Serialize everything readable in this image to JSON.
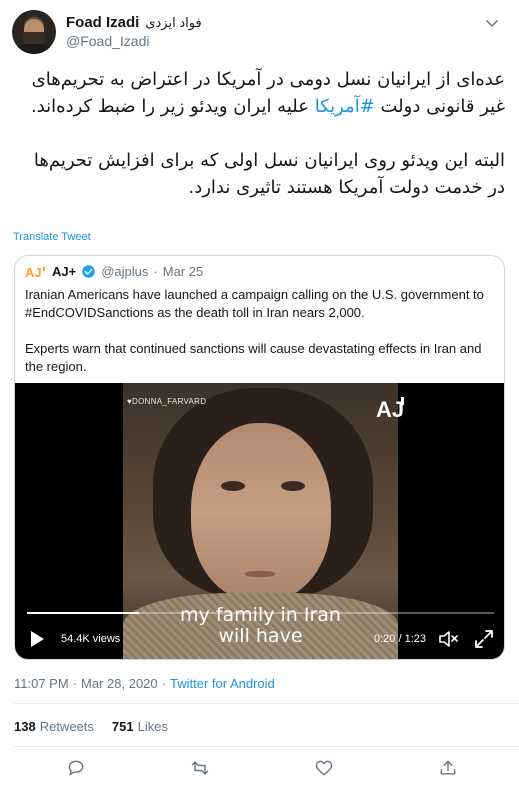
{
  "author": {
    "name": "Foad Izadi",
    "name_fa": "فواد ایزدی",
    "handle": "@Foad_Izadi"
  },
  "tweet": {
    "paragraph1_before": "عده‌ای از ایرانیان نسل دومی در آمریکا در اعتراض به تحریم‌های غیر قانونی دولت ",
    "hashtag": "#آمریکا",
    "paragraph1_after": " علیه ایران ویدئو زیر را ضبط کرده‌اند.",
    "paragraph2": "البته این ویدئو روی ایرانیان نسل اولی که برای افزایش تحریم‌ها در خدمت دولت آمریکا هستند تاثیری ندارد.",
    "translate_label": "Translate Tweet"
  },
  "quoted": {
    "name": "AJ+",
    "handle": "@ajplus",
    "separator": "·",
    "date": "Mar 25",
    "paragraph1": "Iranian Americans have launched a campaign calling on the U.S. government to #EndCOVIDSanctions as the death toll in Iran nears 2,000.",
    "paragraph2": "Experts warn that continued sanctions will cause devastating effects in Iran and the region."
  },
  "video": {
    "watermark": "♥DONNA_FARVARD",
    "caption_line1": "my family in Iran",
    "caption_line2": "will have",
    "views": "54.4K views",
    "time": "0:20 / 1:23",
    "progress": 0.24
  },
  "meta": {
    "time": "11:07 PM",
    "separator1": "·",
    "date": "Mar 28, 2020",
    "separator2": "·",
    "source": "Twitter for Android"
  },
  "stats": {
    "retweets_count": "138",
    "retweets_label": "Retweets",
    "likes_count": "751",
    "likes_label": "Likes"
  },
  "colors": {
    "link": "#1b95e0",
    "secondary_text": "#657786",
    "border": "#ccd6dd"
  },
  "icons": [
    "avatar",
    "chevron-down-icon",
    "aj-logo",
    "verified-icon",
    "play-icon",
    "volume-icon",
    "expand-icon",
    "reply-icon",
    "retweet-icon",
    "like-icon",
    "share-icon"
  ]
}
